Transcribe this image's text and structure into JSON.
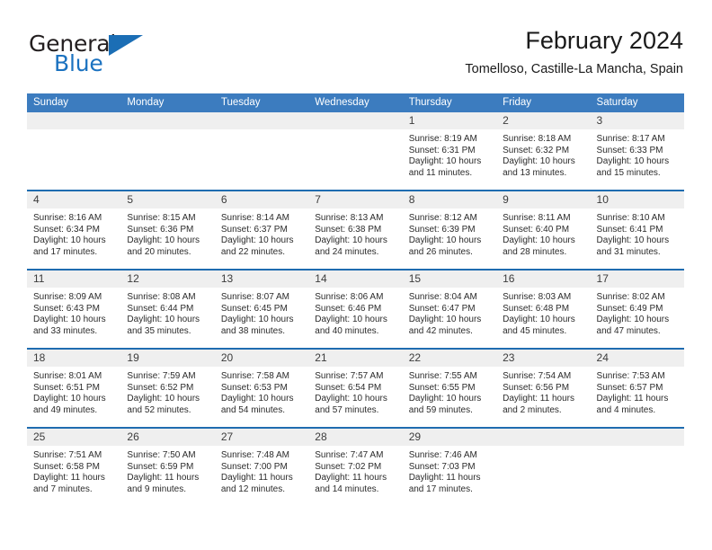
{
  "brand": {
    "name_top": "General",
    "name_bottom": "Blue",
    "accent_color": "#1b6eb5"
  },
  "header": {
    "title": "February 2024",
    "subtitle": "Tomelloso, Castille-La Mancha, Spain"
  },
  "theme": {
    "header_bg": "#3c7cbf",
    "week_divider": "#1f6cb0",
    "day_band_bg": "#efefef",
    "text": "#2b2b2b"
  },
  "weekdays": [
    "Sunday",
    "Monday",
    "Tuesday",
    "Wednesday",
    "Thursday",
    "Friday",
    "Saturday"
  ],
  "weeks": [
    [
      {
        "day": "",
        "empty": true
      },
      {
        "day": "",
        "empty": true
      },
      {
        "day": "",
        "empty": true
      },
      {
        "day": "",
        "empty": true
      },
      {
        "day": "1",
        "sunrise": "Sunrise: 8:19 AM",
        "sunset": "Sunset: 6:31 PM",
        "daylight": "Daylight: 10 hours and 11 minutes."
      },
      {
        "day": "2",
        "sunrise": "Sunrise: 8:18 AM",
        "sunset": "Sunset: 6:32 PM",
        "daylight": "Daylight: 10 hours and 13 minutes."
      },
      {
        "day": "3",
        "sunrise": "Sunrise: 8:17 AM",
        "sunset": "Sunset: 6:33 PM",
        "daylight": "Daylight: 10 hours and 15 minutes."
      }
    ],
    [
      {
        "day": "4",
        "sunrise": "Sunrise: 8:16 AM",
        "sunset": "Sunset: 6:34 PM",
        "daylight": "Daylight: 10 hours and 17 minutes."
      },
      {
        "day": "5",
        "sunrise": "Sunrise: 8:15 AM",
        "sunset": "Sunset: 6:36 PM",
        "daylight": "Daylight: 10 hours and 20 minutes."
      },
      {
        "day": "6",
        "sunrise": "Sunrise: 8:14 AM",
        "sunset": "Sunset: 6:37 PM",
        "daylight": "Daylight: 10 hours and 22 minutes."
      },
      {
        "day": "7",
        "sunrise": "Sunrise: 8:13 AM",
        "sunset": "Sunset: 6:38 PM",
        "daylight": "Daylight: 10 hours and 24 minutes."
      },
      {
        "day": "8",
        "sunrise": "Sunrise: 8:12 AM",
        "sunset": "Sunset: 6:39 PM",
        "daylight": "Daylight: 10 hours and 26 minutes."
      },
      {
        "day": "9",
        "sunrise": "Sunrise: 8:11 AM",
        "sunset": "Sunset: 6:40 PM",
        "daylight": "Daylight: 10 hours and 28 minutes."
      },
      {
        "day": "10",
        "sunrise": "Sunrise: 8:10 AM",
        "sunset": "Sunset: 6:41 PM",
        "daylight": "Daylight: 10 hours and 31 minutes."
      }
    ],
    [
      {
        "day": "11",
        "sunrise": "Sunrise: 8:09 AM",
        "sunset": "Sunset: 6:43 PM",
        "daylight": "Daylight: 10 hours and 33 minutes."
      },
      {
        "day": "12",
        "sunrise": "Sunrise: 8:08 AM",
        "sunset": "Sunset: 6:44 PM",
        "daylight": "Daylight: 10 hours and 35 minutes."
      },
      {
        "day": "13",
        "sunrise": "Sunrise: 8:07 AM",
        "sunset": "Sunset: 6:45 PM",
        "daylight": "Daylight: 10 hours and 38 minutes."
      },
      {
        "day": "14",
        "sunrise": "Sunrise: 8:06 AM",
        "sunset": "Sunset: 6:46 PM",
        "daylight": "Daylight: 10 hours and 40 minutes."
      },
      {
        "day": "15",
        "sunrise": "Sunrise: 8:04 AM",
        "sunset": "Sunset: 6:47 PM",
        "daylight": "Daylight: 10 hours and 42 minutes."
      },
      {
        "day": "16",
        "sunrise": "Sunrise: 8:03 AM",
        "sunset": "Sunset: 6:48 PM",
        "daylight": "Daylight: 10 hours and 45 minutes."
      },
      {
        "day": "17",
        "sunrise": "Sunrise: 8:02 AM",
        "sunset": "Sunset: 6:49 PM",
        "daylight": "Daylight: 10 hours and 47 minutes."
      }
    ],
    [
      {
        "day": "18",
        "sunrise": "Sunrise: 8:01 AM",
        "sunset": "Sunset: 6:51 PM",
        "daylight": "Daylight: 10 hours and 49 minutes."
      },
      {
        "day": "19",
        "sunrise": "Sunrise: 7:59 AM",
        "sunset": "Sunset: 6:52 PM",
        "daylight": "Daylight: 10 hours and 52 minutes."
      },
      {
        "day": "20",
        "sunrise": "Sunrise: 7:58 AM",
        "sunset": "Sunset: 6:53 PM",
        "daylight": "Daylight: 10 hours and 54 minutes."
      },
      {
        "day": "21",
        "sunrise": "Sunrise: 7:57 AM",
        "sunset": "Sunset: 6:54 PM",
        "daylight": "Daylight: 10 hours and 57 minutes."
      },
      {
        "day": "22",
        "sunrise": "Sunrise: 7:55 AM",
        "sunset": "Sunset: 6:55 PM",
        "daylight": "Daylight: 10 hours and 59 minutes."
      },
      {
        "day": "23",
        "sunrise": "Sunrise: 7:54 AM",
        "sunset": "Sunset: 6:56 PM",
        "daylight": "Daylight: 11 hours and 2 minutes."
      },
      {
        "day": "24",
        "sunrise": "Sunrise: 7:53 AM",
        "sunset": "Sunset: 6:57 PM",
        "daylight": "Daylight: 11 hours and 4 minutes."
      }
    ],
    [
      {
        "day": "25",
        "sunrise": "Sunrise: 7:51 AM",
        "sunset": "Sunset: 6:58 PM",
        "daylight": "Daylight: 11 hours and 7 minutes."
      },
      {
        "day": "26",
        "sunrise": "Sunrise: 7:50 AM",
        "sunset": "Sunset: 6:59 PM",
        "daylight": "Daylight: 11 hours and 9 minutes."
      },
      {
        "day": "27",
        "sunrise": "Sunrise: 7:48 AM",
        "sunset": "Sunset: 7:00 PM",
        "daylight": "Daylight: 11 hours and 12 minutes."
      },
      {
        "day": "28",
        "sunrise": "Sunrise: 7:47 AM",
        "sunset": "Sunset: 7:02 PM",
        "daylight": "Daylight: 11 hours and 14 minutes."
      },
      {
        "day": "29",
        "sunrise": "Sunrise: 7:46 AM",
        "sunset": "Sunset: 7:03 PM",
        "daylight": "Daylight: 11 hours and 17 minutes."
      },
      {
        "day": "",
        "empty": true
      },
      {
        "day": "",
        "empty": true
      }
    ]
  ]
}
